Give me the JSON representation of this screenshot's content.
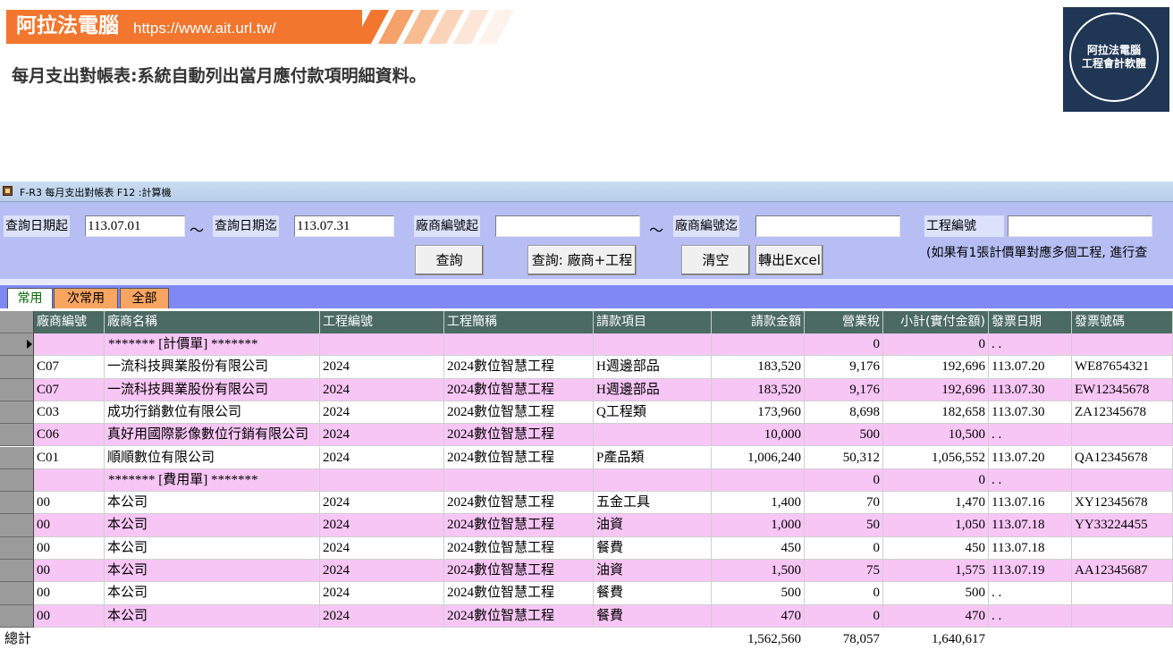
{
  "banner": {
    "title": "阿拉法電腦",
    "url": "https://www.ait.url.tw/",
    "subtitle": "每月支出對帳表:系統自動列出當月應付款項明細資料。",
    "logo_line1": "阿拉法電腦",
    "logo_line2": "工程會計軟體",
    "accent": "#f2762e",
    "logo_bg": "#1f3655"
  },
  "window": {
    "title": "F-R3 每月支出對帳表   F12 :計算機"
  },
  "query": {
    "date_from_label": "查詢日期起",
    "date_from_value": "113.07.01",
    "tilde": "～",
    "date_to_label": "查詢日期迄",
    "date_to_value": "113.07.31",
    "vendor_from_label": "廠商編號起",
    "vendor_from_value": "",
    "vendor_to_label": "廠商編號迄",
    "vendor_to_value": "",
    "project_label": "工程編號",
    "project_value": "",
    "note": "(如果有1張計價單對應多個工程, 進行查",
    "btn_query": "查詢",
    "btn_query_vendor_project": "查詢: 廠商+工程",
    "btn_clear": "清空",
    "btn_excel": "轉出Excel"
  },
  "tabs": [
    {
      "label": "常用",
      "active": true
    },
    {
      "label": "次常用",
      "active": false
    },
    {
      "label": "全部",
      "active": false
    }
  ],
  "columns": [
    "廠商編號",
    "廠商名稱",
    "工程編號",
    "工程簡稱",
    "請款項目",
    "請款金額",
    "營業稅",
    "小計(實付金額)",
    "發票日期",
    "發票號碼"
  ],
  "rows": [
    {
      "vendor_id": "",
      "vendor_name": "******* [計價單] *******",
      "project_id": "",
      "project_name": "",
      "item": "",
      "amount": "",
      "tax": "0",
      "subtotal": "0",
      "invoice_date": " . .",
      "invoice_no": "",
      "bg": "#f7c6f5"
    },
    {
      "vendor_id": "C07",
      "vendor_name": "一流科技興業股份有限公司",
      "project_id": "2024",
      "project_name": "2024數位智慧工程",
      "item": "H週邊部品",
      "amount": "183,520",
      "tax": "9,176",
      "subtotal": "192,696",
      "invoice_date": "113.07.20",
      "invoice_no": "WE87654321",
      "bg": "#ffffff"
    },
    {
      "vendor_id": "C07",
      "vendor_name": "一流科技興業股份有限公司",
      "project_id": "2024",
      "project_name": "2024數位智慧工程",
      "item": "H週邊部品",
      "amount": "183,520",
      "tax": "9,176",
      "subtotal": "192,696",
      "invoice_date": "113.07.30",
      "invoice_no": "EW12345678",
      "bg": "#f7c6f5"
    },
    {
      "vendor_id": "C03",
      "vendor_name": "成功行銷數位有限公司",
      "project_id": "2024",
      "project_name": "2024數位智慧工程",
      "item": "Q工程類",
      "amount": "173,960",
      "tax": "8,698",
      "subtotal": "182,658",
      "invoice_date": "113.07.30",
      "invoice_no": "ZA12345678",
      "bg": "#ffffff"
    },
    {
      "vendor_id": "C06",
      "vendor_name": "真好用國際影像數位行銷有限公司",
      "project_id": "2024",
      "project_name": "2024數位智慧工程",
      "item": "",
      "amount": "10,000",
      "tax": "500",
      "subtotal": "10,500",
      "invoice_date": " . .",
      "invoice_no": "",
      "bg": "#f7c6f5"
    },
    {
      "vendor_id": "C01",
      "vendor_name": "順順數位有限公司",
      "project_id": "2024",
      "project_name": "2024數位智慧工程",
      "item": "P產品類",
      "amount": "1,006,240",
      "tax": "50,312",
      "subtotal": "1,056,552",
      "invoice_date": "113.07.20",
      "invoice_no": "QA12345678",
      "bg": "#ffffff"
    },
    {
      "vendor_id": "",
      "vendor_name": "******* [費用單] *******",
      "project_id": "",
      "project_name": "",
      "item": "",
      "amount": "",
      "tax": "0",
      "subtotal": "0",
      "invoice_date": " . .",
      "invoice_no": "",
      "bg": "#f7c6f5"
    },
    {
      "vendor_id": "00",
      "vendor_name": "本公司",
      "project_id": "2024",
      "project_name": "2024數位智慧工程",
      "item": "五金工具",
      "amount": "1,400",
      "tax": "70",
      "subtotal": "1,470",
      "invoice_date": "113.07.16",
      "invoice_no": "XY12345678",
      "bg": "#ffffff"
    },
    {
      "vendor_id": "00",
      "vendor_name": "本公司",
      "project_id": "2024",
      "project_name": "2024數位智慧工程",
      "item": "油資",
      "amount": "1,000",
      "tax": "50",
      "subtotal": "1,050",
      "invoice_date": "113.07.18",
      "invoice_no": "YY33224455",
      "bg": "#f7c6f5"
    },
    {
      "vendor_id": "00",
      "vendor_name": "本公司",
      "project_id": "2024",
      "project_name": "2024數位智慧工程",
      "item": "餐費",
      "amount": "450",
      "tax": "0",
      "subtotal": "450",
      "invoice_date": "113.07.18",
      "invoice_no": "",
      "bg": "#ffffff"
    },
    {
      "vendor_id": "00",
      "vendor_name": "本公司",
      "project_id": "2024",
      "project_name": "2024數位智慧工程",
      "item": "油資",
      "amount": "1,500",
      "tax": "75",
      "subtotal": "1,575",
      "invoice_date": "113.07.19",
      "invoice_no": "AA12345687",
      "bg": "#f7c6f5"
    },
    {
      "vendor_id": "00",
      "vendor_name": "本公司",
      "project_id": "2024",
      "project_name": "2024數位智慧工程",
      "item": "餐費",
      "amount": "500",
      "tax": "0",
      "subtotal": "500",
      "invoice_date": " . .",
      "invoice_no": "",
      "bg": "#ffffff"
    },
    {
      "vendor_id": "00",
      "vendor_name": "本公司",
      "project_id": "2024",
      "project_name": "2024數位智慧工程",
      "item": "餐費",
      "amount": "470",
      "tax": "0",
      "subtotal": "470",
      "invoice_date": " . .",
      "invoice_no": "",
      "bg": "#f7c6f5"
    }
  ],
  "totals": {
    "label": "總計",
    "amount": "1,562,560",
    "tax": "78,057",
    "subtotal": "1,640,617"
  }
}
